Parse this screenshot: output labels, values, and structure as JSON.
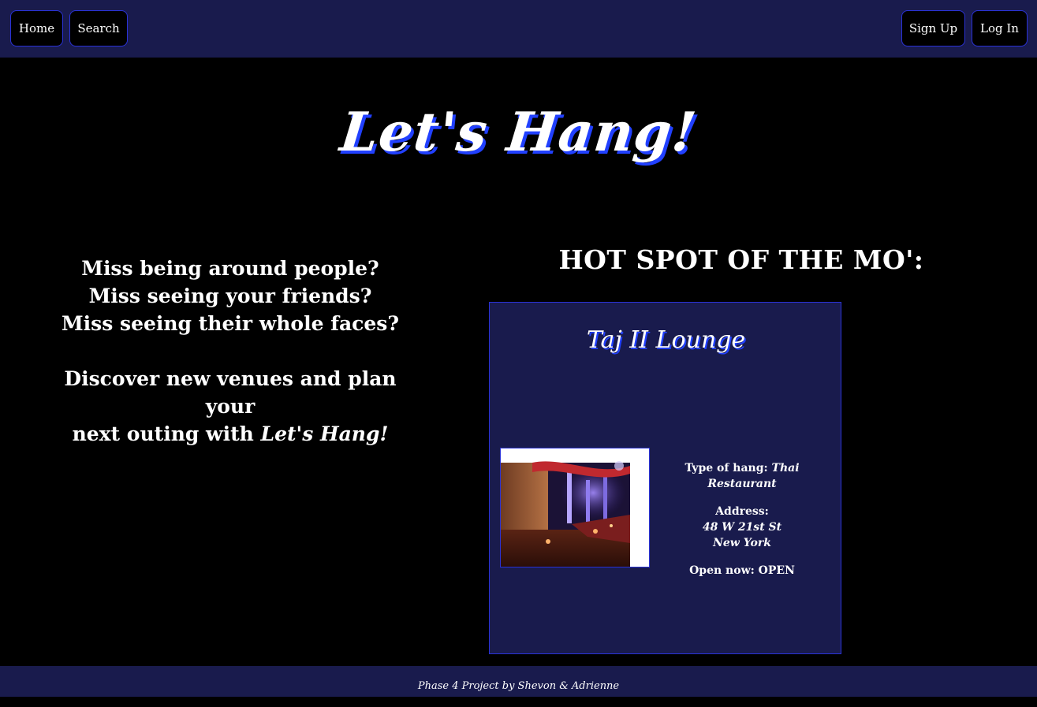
{
  "nav": {
    "home": "Home",
    "search": "Search",
    "signup": "Sign Up",
    "login": "Log In"
  },
  "hero": {
    "title": "Let's Hang!"
  },
  "pitch": {
    "line1": "Miss being around people?",
    "line2": "Miss seeing your friends?",
    "line3": "Miss seeing their whole faces?",
    "line4": "Discover new venues and plan your",
    "line5_prefix": "next outing with ",
    "line5_brand": "Let's Hang!"
  },
  "hotspot": {
    "heading": "HOT SPOT OF THE MO':",
    "name": "Taj II Lounge",
    "image_alt": "Taj II Lounge interior",
    "type_label": "Type of hang: ",
    "type_value": "Thai Restaurant",
    "address_label": "Address:",
    "address_line1": "48 W 21st St",
    "address_line2": "New York",
    "open_label": "Open now: ",
    "open_value": "OPEN"
  },
  "footer": {
    "credit": "Phase 4 Project by Shevon & Adrienne"
  },
  "colors": {
    "navbar_bg": "#191b4d",
    "accent_blue": "#2a32d6",
    "title_shadow": "#2140ff"
  }
}
